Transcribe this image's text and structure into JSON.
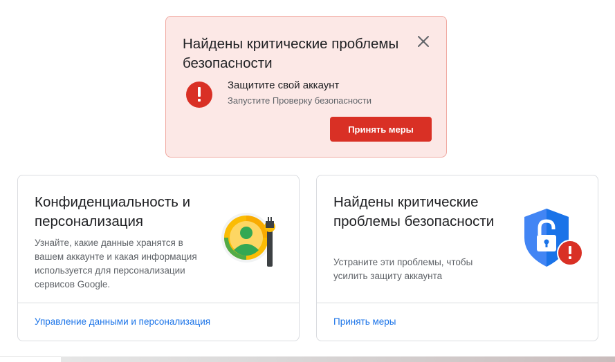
{
  "alert": {
    "title": "Найдены критические проблемы безопасности",
    "message_title": "Защитите свой аккаунт",
    "message_subtitle": "Запустите Проверку безопасности",
    "button_label": "Принять меры",
    "colors": {
      "background": "#fce8e6",
      "border": "#f0a8a0",
      "accent": "#d93025"
    },
    "icons": {
      "close": "close-icon",
      "status": "error-icon"
    }
  },
  "cards": {
    "privacy": {
      "title": "Конфиденциальность и персонализация",
      "description": "Узнайте, какие данные хранятся в вашем аккаунте и какая информация используется для персонализации сервисов Google.",
      "link_label": "Управление данными и персонализация",
      "illustration": "privacy-personalization-illustration"
    },
    "security": {
      "title": "Найдены критические проблемы безопасности",
      "description": "Устраните эти проблемы, чтобы усилить защиту аккаунта",
      "link_label": "Принять меры",
      "illustration": "security-shield-illustration"
    }
  },
  "colors": {
    "link": "#1a73e8",
    "text_primary": "#202124",
    "text_secondary": "#5f6368",
    "divider": "#dadce0"
  }
}
